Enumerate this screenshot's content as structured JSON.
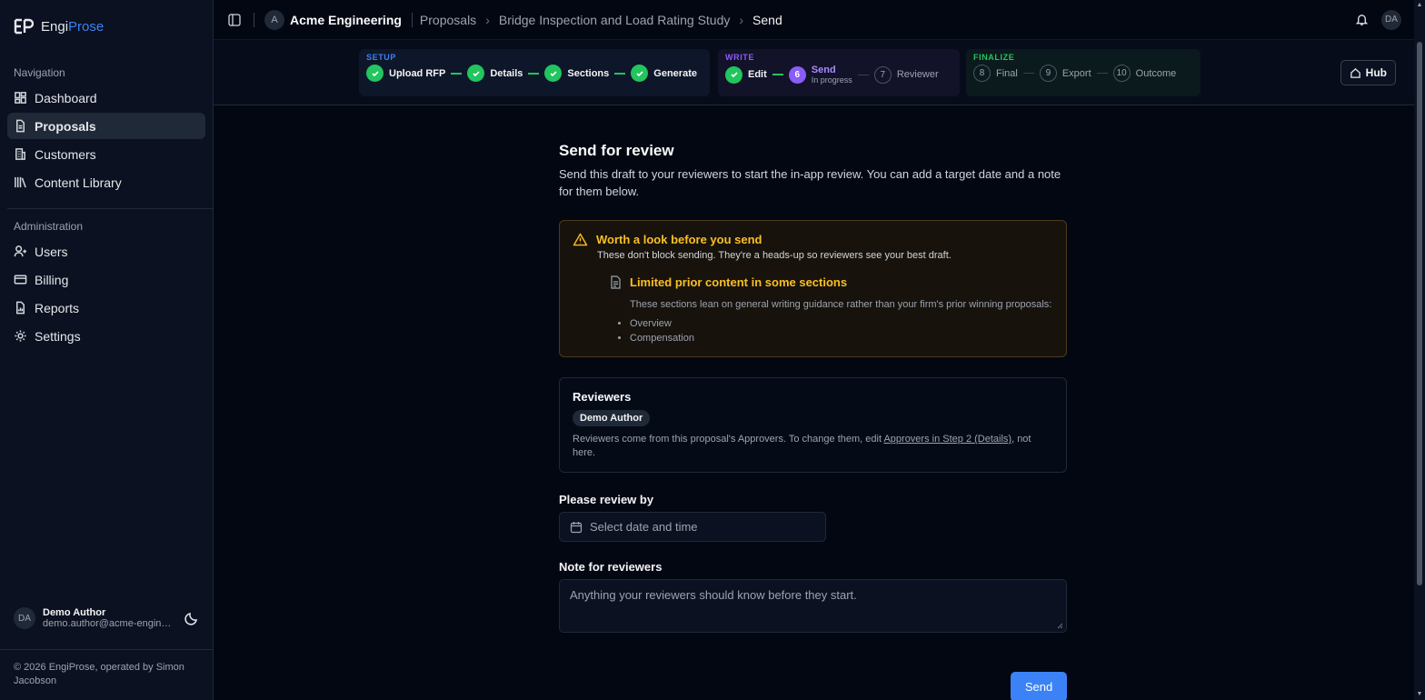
{
  "brand": {
    "prefix": "Engi",
    "suffix": "Prose"
  },
  "sidebar": {
    "nav_title": "Navigation",
    "nav_items": [
      {
        "label": "Dashboard",
        "icon": "dashboard-icon"
      },
      {
        "label": "Proposals",
        "icon": "document-icon",
        "active": true
      },
      {
        "label": "Customers",
        "icon": "building-icon"
      },
      {
        "label": "Content Library",
        "icon": "library-icon"
      }
    ],
    "admin_title": "Administration",
    "admin_items": [
      {
        "label": "Users",
        "icon": "users-icon"
      },
      {
        "label": "Billing",
        "icon": "credit-card-icon"
      },
      {
        "label": "Reports",
        "icon": "report-icon"
      },
      {
        "label": "Settings",
        "icon": "gear-icon"
      }
    ],
    "user": {
      "initials": "DA",
      "name": "Demo Author",
      "email": "demo.author@acme-engineering.com"
    },
    "footer": "© 2026 EngiProse, operated by Simon Jacobson"
  },
  "topbar": {
    "org_initial": "A",
    "org_name": "Acme Engineering",
    "crumbs": [
      "Proposals",
      "Bridge Inspection and Load Rating Study",
      "Send"
    ],
    "user_initials": "DA"
  },
  "stepper": {
    "setup_title": "SETUP",
    "setup_steps": [
      "Upload RFP",
      "Details",
      "Sections",
      "Generate"
    ],
    "write_title": "WRITE",
    "write_steps": [
      {
        "label": "Edit",
        "state": "done"
      },
      {
        "num": "6",
        "label": "Send",
        "sub": "In progress",
        "state": "active"
      },
      {
        "num": "7",
        "label": "Reviewer",
        "state": "todo"
      }
    ],
    "finalize_title": "FINALIZE",
    "finalize_steps": [
      {
        "num": "8",
        "label": "Final"
      },
      {
        "num": "9",
        "label": "Export"
      },
      {
        "num": "10",
        "label": "Outcome"
      }
    ],
    "hub_label": "Hub"
  },
  "content": {
    "title": "Send for review",
    "description": "Send this draft to your reviewers to start the in-app review. You can add a target date and a note for them below.",
    "warning": {
      "title": "Worth a look before you send",
      "subtitle": "These don't block sending. They're a heads-up so reviewers see your best draft.",
      "issue_title": "Limited prior content in some sections",
      "issue_body": "These sections lean on general writing guidance rather than your firm's prior winning proposals:",
      "issue_items": [
        "Overview",
        "Compensation"
      ]
    },
    "reviewers": {
      "title": "Reviewers",
      "chip": "Demo Author",
      "note_before": "Reviewers come from this proposal's Approvers. To change them, edit ",
      "note_link": "Approvers in Step 2 (Details)",
      "note_after": ", not here."
    },
    "review_by_label": "Please review by",
    "date_placeholder": "Select date and time",
    "note_label": "Note for reviewers",
    "note_placeholder": "Anything your reviewers should know before they start.",
    "send_label": "Send"
  },
  "colors": {
    "accent": "#3b82f6",
    "success": "#22c55e",
    "active": "#8b5cf6",
    "warning": "#fbbf24"
  }
}
